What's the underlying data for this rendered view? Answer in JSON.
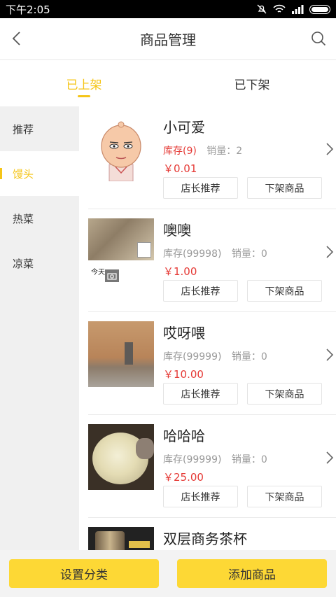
{
  "status_bar": {
    "time": "下午2:05"
  },
  "header": {
    "title": "商品管理"
  },
  "tabs": [
    {
      "label": "已上架"
    },
    {
      "label": "已下架"
    }
  ],
  "sidebar": {
    "categories": [
      "推荐",
      "馒头",
      "热菜",
      "凉菜"
    ]
  },
  "products": [
    {
      "name": "小可爱",
      "stock": "库存(9)",
      "sales": "销量：2",
      "price": "￥0.01"
    },
    {
      "name": "噢噢",
      "stock": "库存(99998)",
      "sales": "销量：0",
      "price": "￥1.00",
      "thumb_caption": "今天"
    },
    {
      "name": "哎呀喂",
      "stock": "库存(99999)",
      "sales": "销量：0",
      "price": "￥10.00"
    },
    {
      "name": "哈哈哈",
      "stock": "库存(99999)",
      "sales": "销量：0",
      "price": "￥25.00"
    },
    {
      "name": "双层商务茶杯"
    }
  ],
  "actions": {
    "recommend": "店长推荐",
    "delist": "下架商品"
  },
  "footer": {
    "set_category": "设置分类",
    "add_product": "添加商品"
  },
  "colors": {
    "accent": "#f5c518",
    "button": "#fdd835",
    "price": "#e53935"
  }
}
